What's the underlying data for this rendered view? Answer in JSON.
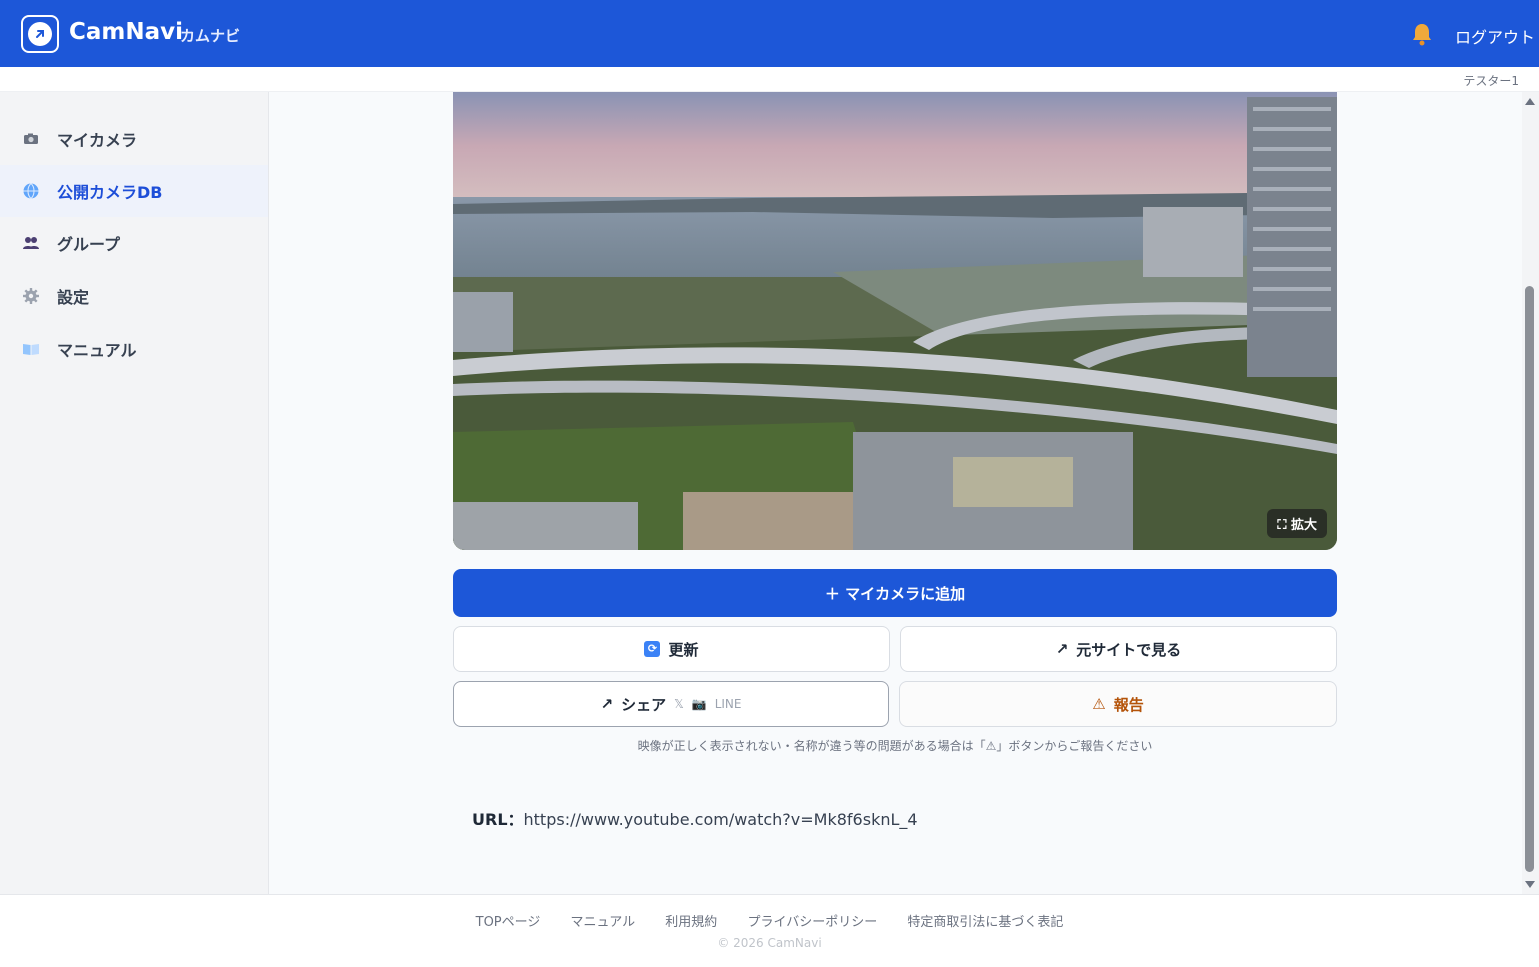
{
  "header": {
    "brand": "CamNavi",
    "brand_sub": "カムナビ",
    "logout_label": "ログアウト",
    "username": "テスター1"
  },
  "sidebar": {
    "items": [
      {
        "label": "マイカメラ",
        "icon": "camera-icon",
        "active": false
      },
      {
        "label": "公開カメラDB",
        "icon": "globe-icon",
        "active": true
      },
      {
        "label": "グループ",
        "icon": "users-icon",
        "active": false
      },
      {
        "label": "設定",
        "icon": "gear-icon",
        "active": false
      },
      {
        "label": "マニュアル",
        "icon": "book-icon",
        "active": false
      }
    ]
  },
  "player": {
    "expand_label": "拡大"
  },
  "actions": {
    "add_label": "マイカメラに追加",
    "refresh_label": "更新",
    "source_label": "元サイトで見る",
    "share_label": "シェア",
    "share_x": "𝕏",
    "share_line": "LINE",
    "report_label": "報告"
  },
  "notice": "映像が正しく表示されない・名称が違う等の問題がある場合は「⚠」ボタンからご報告ください",
  "url": {
    "label": "URL：",
    "value": "https://www.youtube.com/watch?v=Mk8f6sknL_4"
  },
  "footer": {
    "links": [
      "TOPページ",
      "マニュアル",
      "利用規約",
      "プライバシーポリシー",
      "特定商取引法に基づく表記"
    ],
    "copyright": "© 2026 CamNavi"
  },
  "colors": {
    "primary": "#1d57d8",
    "report": "#b45309",
    "sidebar_active_bg": "#eef2fb"
  }
}
